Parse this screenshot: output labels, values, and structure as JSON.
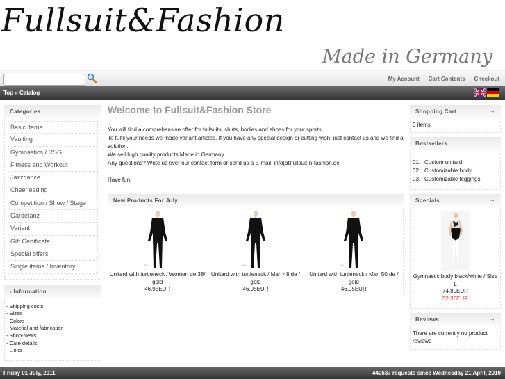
{
  "header": {
    "logo": "Fullsuit&Fashion",
    "tagline": "Made in Germany"
  },
  "topbar": {
    "search_value": "",
    "search_placeholder": "",
    "links": [
      "My Account",
      "Cart Contents",
      "Checkout"
    ]
  },
  "breadcrumb": {
    "text": "Top » Catalog",
    "languages": [
      "English",
      "Deutsch"
    ]
  },
  "categories": {
    "title": "Categories",
    "items": [
      "Basic items",
      "Vaulting",
      "Gymnastics / RSG",
      "Fitness and Workout",
      "Jazzdance",
      "Cheerleading",
      "Competition / Show / Stage",
      "Gardetanz",
      "Variant",
      "Gift Certificate",
      "Special offers",
      "Single items / Inventory"
    ]
  },
  "information": {
    "title": "- Information",
    "items": [
      "- Shipping costs",
      "- Sizes",
      "- Colors",
      "- Material and fabrication",
      "- Shop-News",
      "- Care details",
      "- Links"
    ]
  },
  "main": {
    "welcome_title": "Welcome to Fullsuit&Fashion Store",
    "paragraph_1": "You will find a comprehensive offer for fullsuits, shirts, bodies and shoes for your sports.",
    "paragraph_2": "To fulfil your needs we made variant articles. If you have any special design or cutting wish, just contact us and we find a solution.",
    "paragraph_3": "We sell high quality products Made in Germany.",
    "paragraph_4_before": "Any questions? Write us over our ",
    "contact_link": "contact form",
    "paragraph_4_after": " or send us a E-mail: info(at)fullsuit-n-fashion.de",
    "closing": "Have fun.",
    "new_products_title": "New Products For July",
    "products": [
      {
        "name": "Unitard with turtleneck / Women de 38/ gold",
        "price": "46.95EUR"
      },
      {
        "name": "Unitard with turtleneck / Man 48 de / gold",
        "price": "46.95EUR"
      },
      {
        "name": "Unitard with turtleneck / Man 50 de / gold",
        "price": "46.95EUR"
      }
    ]
  },
  "right": {
    "cart_title": "Shopping Cart",
    "cart_arrow": "→",
    "cart_text": "0 items",
    "bestsellers_title": "Bestsellers",
    "bestsellers": [
      {
        "num": "01.",
        "name": "Custom unitard"
      },
      {
        "num": "02.",
        "name": "Customizable body"
      },
      {
        "num": "03.",
        "name": "Customizable leggings"
      }
    ],
    "specials_title": "Specials",
    "specials_arrow": "→",
    "special_name": "Gymnastic body black/white / Size L",
    "special_old_price": "74.80EUR",
    "special_new_price": "52.36EUR",
    "reviews_title": "Reviews",
    "reviews_arrow": "→",
    "reviews_text": "There are currently no product reviews"
  },
  "footer": {
    "date": "Friday 01 July, 2011",
    "counter": "440637 requests since Wednesday 21 April, 2010"
  },
  "colors": {
    "special_price": "#ee3333",
    "bar_dark": "#333333",
    "heading_gray": "#999999"
  }
}
